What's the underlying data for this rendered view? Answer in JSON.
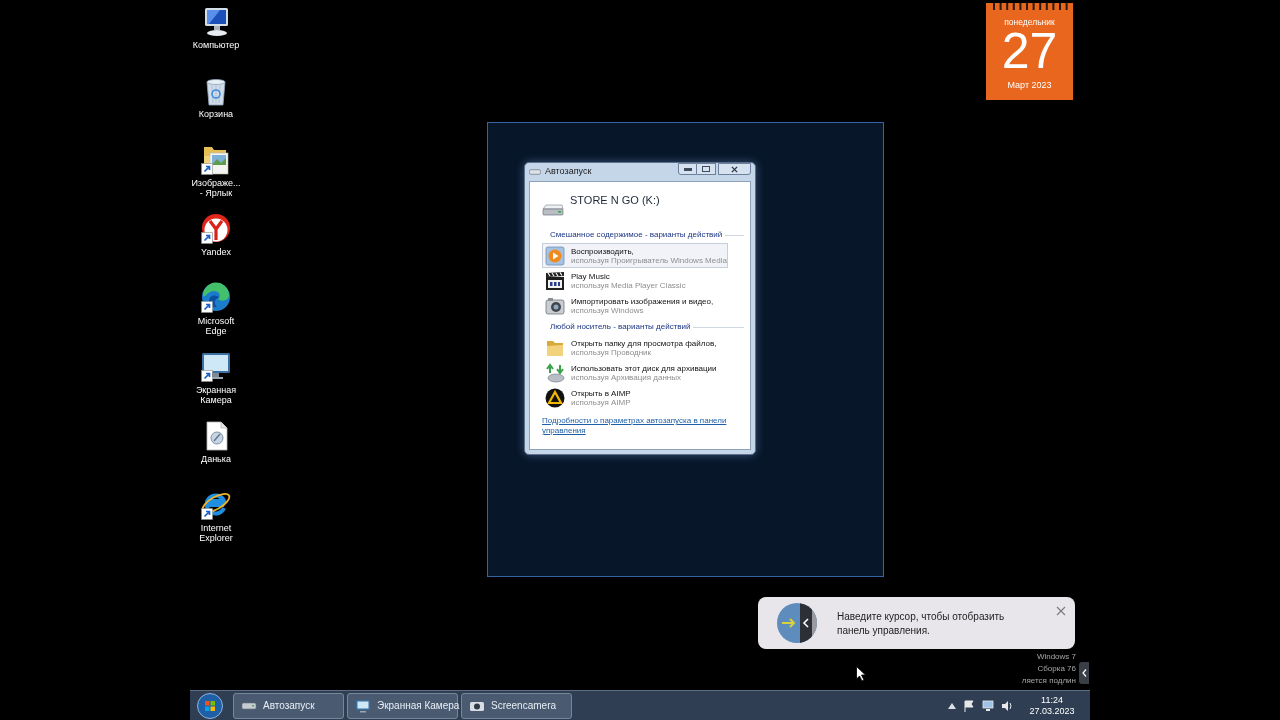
{
  "desktop_icons": [
    {
      "kind": "computer",
      "label": [
        "Компьютер"
      ],
      "shortcut": false
    },
    {
      "kind": "recycle_bin",
      "label": [
        "Корзина"
      ],
      "shortcut": false
    },
    {
      "kind": "folder",
      "label": [
        "Изображе...",
        "- Ярлык"
      ],
      "shortcut": true
    },
    {
      "kind": "yandex",
      "label": [
        "Yandex"
      ],
      "shortcut": true
    },
    {
      "kind": "edge",
      "label": [
        "Microsoft",
        "Edge"
      ],
      "shortcut": true
    },
    {
      "kind": "monitor",
      "label": [
        "Экранная",
        "Камера"
      ],
      "shortcut": true
    },
    {
      "kind": "document",
      "label": [
        "Данька"
      ],
      "shortcut": false
    },
    {
      "kind": "ie",
      "label": [
        "Internet",
        "Explorer"
      ],
      "shortcut": true
    }
  ],
  "calendar_gadget": {
    "weekday": "понедельник",
    "day": "27",
    "month_year": "Март 2023"
  },
  "autoplay_window": {
    "title": "Автозапуск",
    "device": "STORE N GO (K:)",
    "sections": [
      {
        "heading": "Смешанное содержимое - варианты действий",
        "options": [
          {
            "kind": "media_player",
            "title": "Воспроизводить,",
            "subtitle": "используя Проигрыватель Windows Media",
            "selected": true
          },
          {
            "kind": "clapperboard",
            "title": "Play Music",
            "subtitle": "используя Media Player Classic",
            "selected": false
          },
          {
            "kind": "camera",
            "title": "Импортировать изображения и видео,",
            "subtitle": "используя Windows",
            "selected": false
          }
        ]
      },
      {
        "heading": "Любой носитель - варианты действий",
        "options": [
          {
            "kind": "folder",
            "title": "Открыть папку для просмотра файлов,",
            "subtitle": "используя Проводник",
            "selected": false
          },
          {
            "kind": "backup",
            "title": "Использовать этот диск для архивации",
            "subtitle": "используя Архивация данных",
            "selected": false
          },
          {
            "kind": "aimp",
            "title": "Открыть в AIMP",
            "subtitle": "используя AIMP",
            "selected": false
          }
        ]
      }
    ],
    "link": "Подробности о параметрах автозапуска в панели управления"
  },
  "notification": {
    "text": "Наведите курсор, чтобы отобразить панель управления."
  },
  "os_notice": [
    "Windows 7",
    "Сборка 76",
    "ляется подлин"
  ],
  "taskbar": {
    "buttons": [
      {
        "kind": "drive",
        "label": "Автозапуск"
      },
      {
        "kind": "monitor",
        "label": "Экранная Камера"
      },
      {
        "kind": "camera",
        "label": "Screencamera"
      }
    ],
    "clock": {
      "time": "11:24",
      "date": "27.03.2023"
    }
  }
}
